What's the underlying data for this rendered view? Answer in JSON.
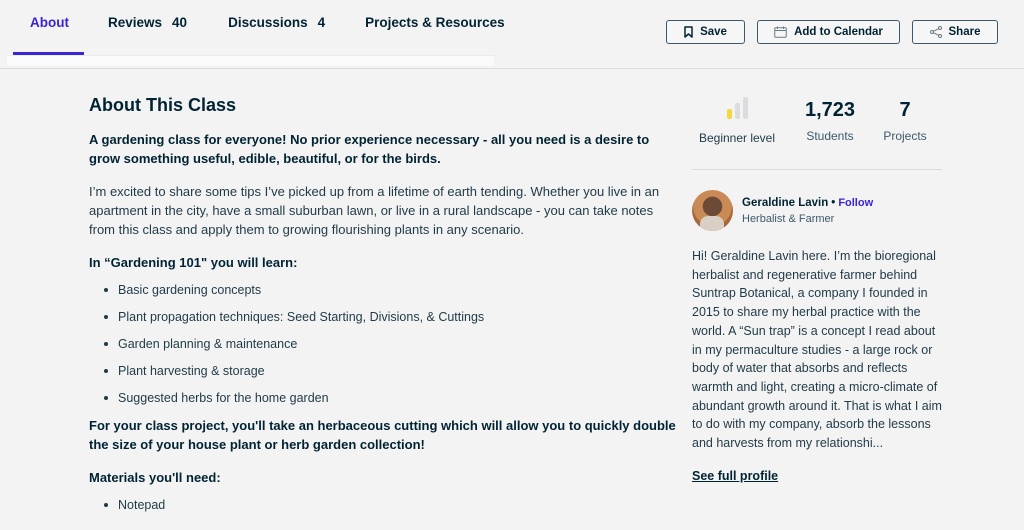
{
  "tabs": [
    {
      "label": "About",
      "count": null,
      "active": true
    },
    {
      "label": "Reviews",
      "count": "40",
      "active": false
    },
    {
      "label": "Discussions",
      "count": "4",
      "active": false
    },
    {
      "label": "Projects & Resources",
      "count": null,
      "active": false
    }
  ],
  "actions": {
    "save_label": "Save",
    "calendar_label": "Add to Calendar",
    "share_label": "Share"
  },
  "about": {
    "title": "About This Class",
    "lead": "A gardening class for everyone! No prior experience necessary - all you need is a desire to grow something useful, edible, beautiful, or for the birds.",
    "intro": "I’m excited to share some tips I’ve picked up from a lifetime of earth tending. Whether you live in an apartment in the city, have a small suburban lawn, or live in a rural landscape - you can take notes from this class and apply them to growing flourishing plants in any scenario.",
    "learn_heading": "In “Gardening 101\" you will learn:",
    "learn_items": [
      "Basic gardening concepts",
      "Plant propagation techniques: Seed Starting, Divisions, & Cuttings",
      "Garden planning & maintenance",
      "Plant harvesting & storage",
      "Suggested herbs for the home garden"
    ],
    "project": "For your class project, you'll take an herbaceous cutting which will allow you to quickly double the size of your house plant or herb garden collection!",
    "materials_heading": "Materials you'll need:",
    "materials_items": [
      "Notepad"
    ]
  },
  "stats": {
    "level_label": "Beginner level",
    "level_value": 1,
    "level_max": 3,
    "level_colors": {
      "active": "#f5d63d",
      "inactive": "#dcdcde"
    },
    "students_value": "1,723",
    "students_label": "Students",
    "projects_value": "7",
    "projects_label": "Projects"
  },
  "teacher": {
    "name": "Geraldine Lavin",
    "separator": "•",
    "follow_label": "Follow",
    "title": "Herbalist & Farmer",
    "bio": "Hi! Geraldine Lavin here. I’m the bioregional herbalist and regenerative farmer behind Suntrap Botanical, a company I founded in 2015 to share my herbal practice with the world. A “Sun trap” is a concept I read about in my permaculture studies - a large rock or body of water that absorbs and reflects warmth and light, creating a micro-climate of abundant growth around it. That is what I aim to do with my company, absorb the lessons and harvests from my relationshi...",
    "profile_link": "See full profile"
  },
  "colors": {
    "accent": "#3b23d6",
    "text": "#002333",
    "background": "#f3f3f3"
  }
}
